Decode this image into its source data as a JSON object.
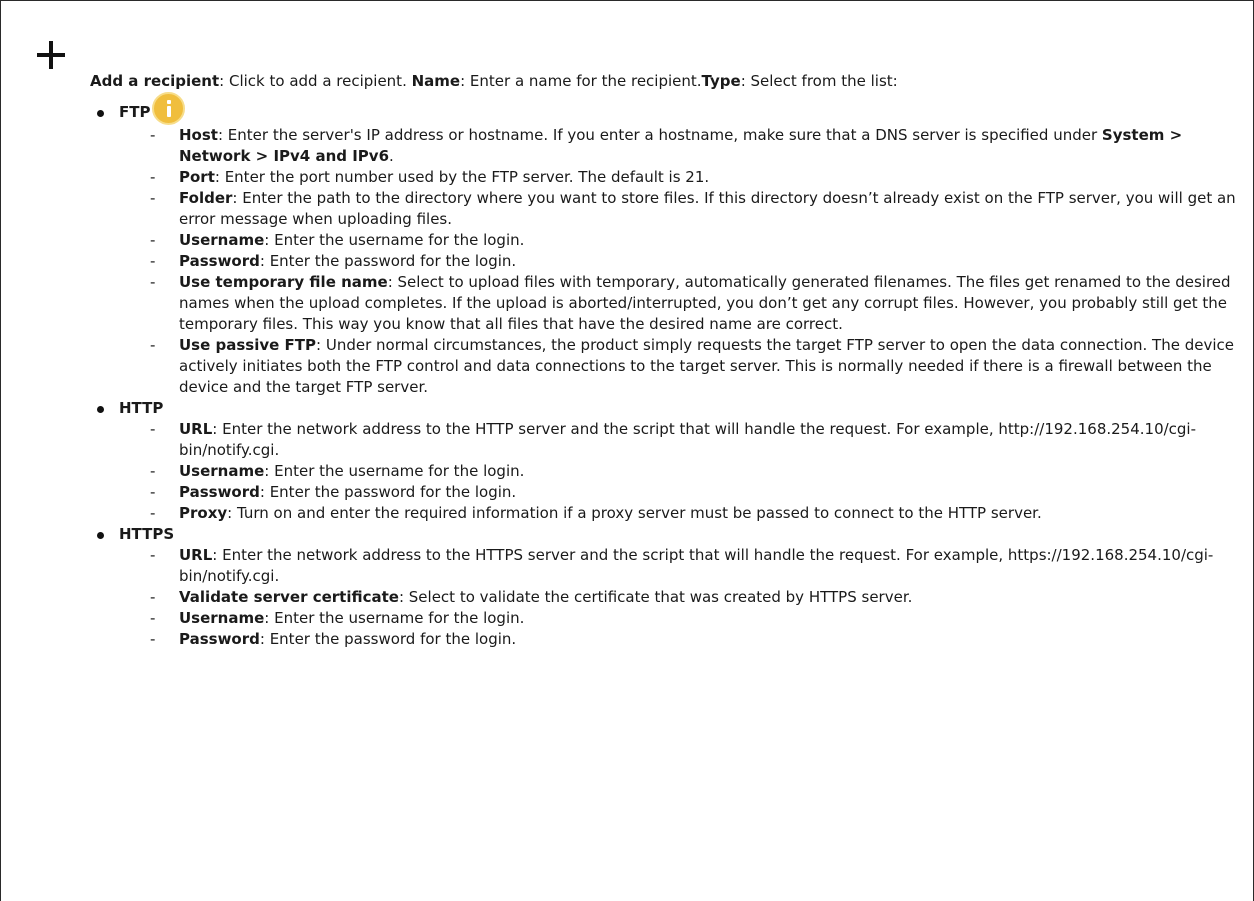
{
  "intro": {
    "add_label": "Add a recipient",
    "add_text": ": Click to add a recipient. ",
    "name_label": "Name",
    "name_text": ": Enter a name for the recipient.",
    "type_label": "Type",
    "type_text": ": Select from the list:"
  },
  "icons": {
    "add": "plus-icon",
    "info": "info-icon",
    "info_color": "#f0be3d"
  },
  "types": [
    {
      "name": "FTP",
      "fields": [
        {
          "label": "Host",
          "text": ": Enter the server's IP address or hostname. If you enter a hostname, make sure that a DNS server is specified under ",
          "path": "System > Network > IPv4 and IPv6",
          "after": "."
        },
        {
          "label": "Port",
          "text": ": Enter the port number used by the FTP server. The default is 21."
        },
        {
          "label": "Folder",
          "text": ": Enter the path to the directory where you want to store files. If this directory doesn’t already exist on the FTP server, you will get an error message when uploading files."
        },
        {
          "label": "Username",
          "text": ": Enter the username for the login."
        },
        {
          "label": "Password",
          "text": ": Enter the password for the login."
        },
        {
          "label": "Use temporary file name",
          "text": ": Select to upload files with temporary, automatically generated filenames. The files get renamed to the desired names when the upload completes. If the upload is aborted/interrupted, you don’t get any corrupt files. However, you probably still get the temporary files. This way you know that all files that have the desired name are correct."
        },
        {
          "label": "Use passive FTP",
          "text": ": Under normal circumstances, the product simply requests the target FTP server to open the data connection. The device actively initiates both the FTP control and data connections to the target server. This is normally needed if there is a firewall between the device and the target FTP server."
        }
      ]
    },
    {
      "name": "HTTP",
      "fields": [
        {
          "label": "URL",
          "text": ": Enter the network address to the HTTP server and the script that will handle the request. For example, http://192.168.254.10/cgi-bin/notify.cgi."
        },
        {
          "label": "Username",
          "text": ": Enter the username for the login."
        },
        {
          "label": "Password",
          "text": ": Enter the password for the login."
        },
        {
          "label": "Proxy",
          "text": ": Turn on and enter the required information if a proxy server must be passed to connect to the HTTP server."
        }
      ]
    },
    {
      "name": "HTTPS",
      "fields": [
        {
          "label": "URL",
          "text": ": Enter the network address to the HTTPS server and the script that will handle the request. For example, https://192.168.254.10/cgi-bin/notify.cgi."
        },
        {
          "label": "Validate server certificate",
          "text": ": Select to validate the certificate that was created by HTTPS server."
        },
        {
          "label": "Username",
          "text": ": Enter the username for the login."
        },
        {
          "label": "Password",
          "text": ": Enter the password for the login."
        }
      ]
    }
  ]
}
